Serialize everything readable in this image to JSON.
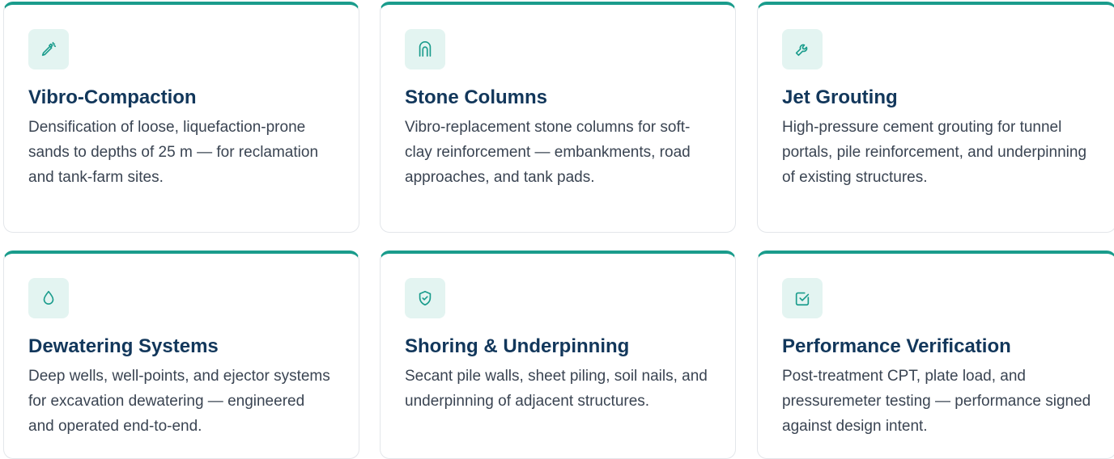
{
  "accent_color": "#1a9c8c",
  "heading_color": "#12375b",
  "icon_bg_color": "#e3f4f1",
  "services": [
    {
      "icon": "vibro-tool-icon",
      "title": "Vibro-Compaction",
      "description": "Densification of loose, liquefaction-prone sands to depths of 25 m — for reclamation and tank-farm sites."
    },
    {
      "icon": "column-icon",
      "title": "Stone Columns",
      "description": "Vibro-replacement stone columns for soft-clay reinforcement — embankments, road approaches, and tank pads."
    },
    {
      "icon": "wrench-icon",
      "title": "Jet Grouting",
      "description": "High-pressure cement grouting for tunnel portals, pile reinforcement, and underpinning of existing structures."
    },
    {
      "icon": "water-drop-icon",
      "title": "Dewatering Systems",
      "description": "Deep wells, well-points, and ejector systems for excavation dewatering — engineered and operated end-to-end."
    },
    {
      "icon": "shield-check-icon",
      "title": "Shoring & Underpinning",
      "description": "Secant pile walls, sheet piling, soil nails, and underpinning of adjacent structures."
    },
    {
      "icon": "checkbox-icon",
      "title": "Performance Verification",
      "description": "Post-treatment CPT, plate load, and pressuremeter testing — performance signed against design intent."
    }
  ]
}
